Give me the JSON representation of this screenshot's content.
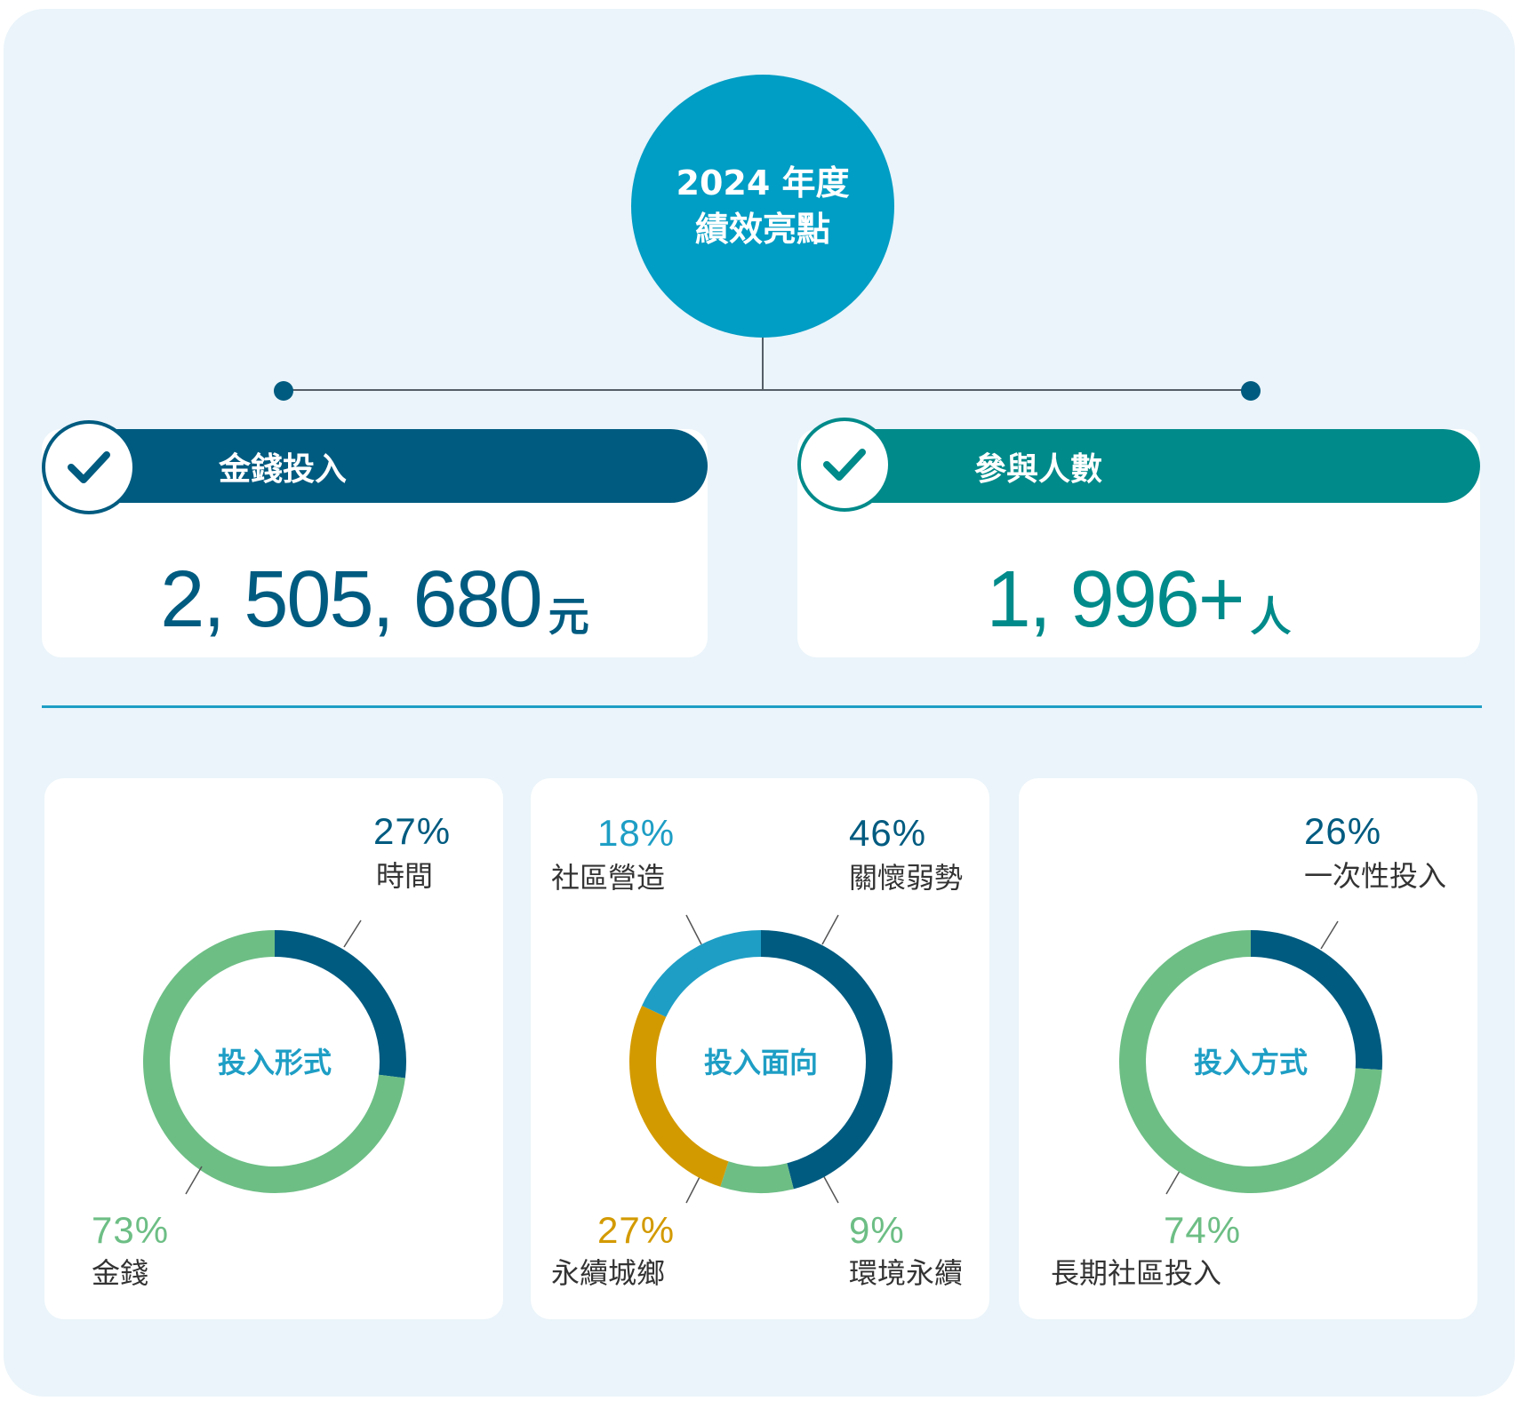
{
  "header": {
    "line1": "2024 年度",
    "line2": "績效亮點"
  },
  "kpis": [
    {
      "label": "金錢投入",
      "value": "2, 505, 680",
      "unit": "元",
      "color": "#005b80"
    },
    {
      "label": "參與人數",
      "value": "1, 996+",
      "unit": "人",
      "color": "#008a8a"
    }
  ],
  "colors": {
    "dark_blue": "#005b80",
    "light_blue": "#1e9ec5",
    "green": "#6dbe85",
    "gold": "#d39a00",
    "background": "#eaf4fa"
  },
  "chart_data": [
    {
      "type": "pie",
      "title": "投入形式",
      "slices": [
        {
          "label": "時間",
          "value": 27,
          "display": "27%",
          "color": "#005b80"
        },
        {
          "label": "金錢",
          "value": 73,
          "display": "73%",
          "color": "#6dbe85"
        }
      ]
    },
    {
      "type": "pie",
      "title": "投入面向",
      "slices": [
        {
          "label": "關懷弱勢",
          "value": 46,
          "display": "46%",
          "color": "#005b80"
        },
        {
          "label": "環境永續",
          "value": 9,
          "display": "9%",
          "color": "#6dbe85"
        },
        {
          "label": "永續城鄉",
          "value": 27,
          "display": "27%",
          "color": "#d39a00"
        },
        {
          "label": "社區營造",
          "value": 18,
          "display": "18%",
          "color": "#1e9ec5"
        }
      ]
    },
    {
      "type": "pie",
      "title": "投入方式",
      "slices": [
        {
          "label": "一次性投入",
          "value": 26,
          "display": "26%",
          "color": "#005b80"
        },
        {
          "label": "長期社區投入",
          "value": 74,
          "display": "74%",
          "color": "#6dbe85"
        }
      ]
    }
  ]
}
